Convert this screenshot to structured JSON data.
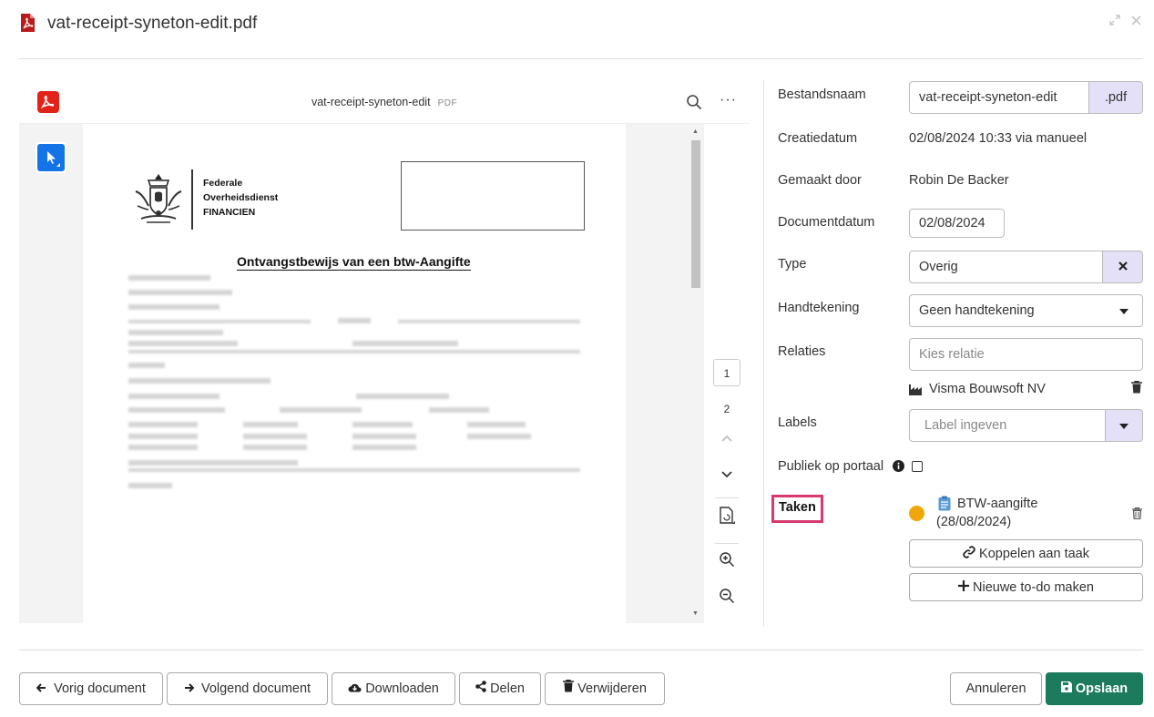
{
  "window": {
    "title": "vat-receipt-syneton-edit.pdf",
    "expand_icon": "expand-icon",
    "close_icon": "close-icon"
  },
  "viewer": {
    "file_name": "vat-receipt-syneton-edit",
    "file_ext": "PDF",
    "pages": [
      "1",
      "2"
    ],
    "current_page": "1",
    "document": {
      "org_line1": "Federale",
      "org_line2": "Overheidsdienst",
      "org_line3": "FINANCIEN",
      "heading": "Ontvangstbewijs van een btw-Aangifte"
    }
  },
  "fields": {
    "bestandsnaam": {
      "label": "Bestandsnaam",
      "value": "vat-receipt-syneton-edit",
      "addon": ".pdf"
    },
    "creatiedatum": {
      "label": "Creatiedatum",
      "value": "02/08/2024 10:33 via manueel"
    },
    "gemaakt_door": {
      "label": "Gemaakt door",
      "value": "Robin De Backer"
    },
    "documentdatum": {
      "label": "Documentdatum",
      "value": "02/08/2024"
    },
    "type": {
      "label": "Type",
      "value": "Overig"
    },
    "handtekening": {
      "label": "Handtekening",
      "value": "Geen handtekening"
    },
    "relaties": {
      "label": "Relaties",
      "placeholder": "Kies relatie",
      "items": [
        "Visma Bouwsoft NV"
      ]
    },
    "labels": {
      "label": "Labels",
      "placeholder": "Label ingeven"
    },
    "publiek": {
      "label": "Publiek op portaal",
      "checked": false
    },
    "taken": {
      "label": "Taken",
      "task_title": "BTW-aangifte",
      "task_date": "(28/08/2024)",
      "status_color": "#f0a70a",
      "link_button": "Koppelen aan taak",
      "new_button": "Nieuwe to-do maken"
    }
  },
  "footer": {
    "prev": "Vorig document",
    "next": "Volgend document",
    "download": "Downloaden",
    "share": "Delen",
    "delete": "Verwijderen",
    "cancel": "Annuleren",
    "save": "Opslaan"
  },
  "colors": {
    "accent": "#1c7a5d",
    "addon": "#e3e0f7",
    "highlight": "#d63a6e",
    "pdf_red": "#e2231a",
    "tool_blue": "#1473e6"
  }
}
